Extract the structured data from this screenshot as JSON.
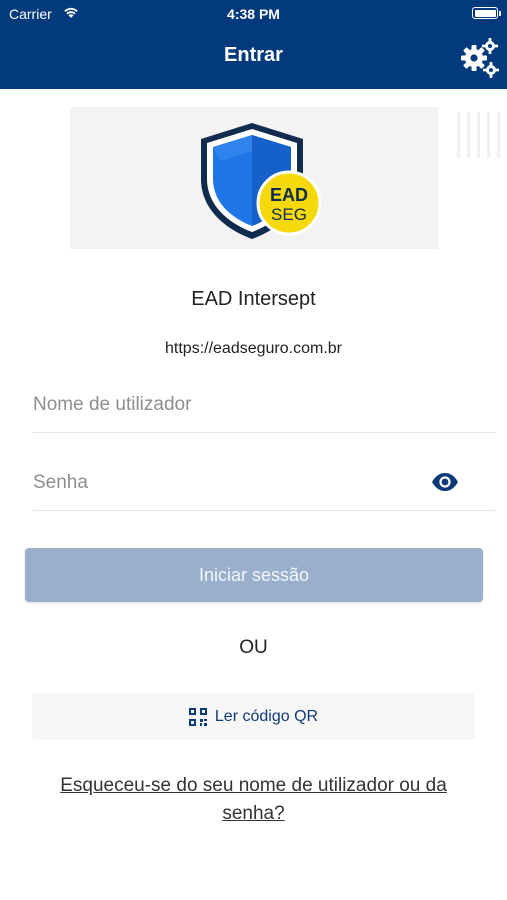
{
  "status_bar": {
    "carrier": "Carrier",
    "time": "4:38 PM"
  },
  "nav": {
    "title": "Entrar",
    "settings_icon": "gears-icon"
  },
  "colors": {
    "nav_background": "#033a7d",
    "login_button": "#99afcc",
    "qr_text": "#0d3a78",
    "logo_badge": "#f6d90b",
    "shield_blue": "#1f76e6"
  },
  "logo": {
    "badge_line1": "EAD",
    "badge_line2": "SEG"
  },
  "site": {
    "name": "EAD Intersept",
    "url": "https://eadseguro.com.br"
  },
  "form": {
    "username_placeholder": "Nome de utilizador",
    "password_placeholder": "Senha",
    "show_password_icon": "eye-icon",
    "login_label": "Iniciar sessão",
    "or_label": "OU",
    "qr_label": "Ler código QR",
    "qr_icon": "qr-code-icon",
    "forgot_label": "Esqueceu-se do seu nome de utilizador ou da senha?"
  }
}
